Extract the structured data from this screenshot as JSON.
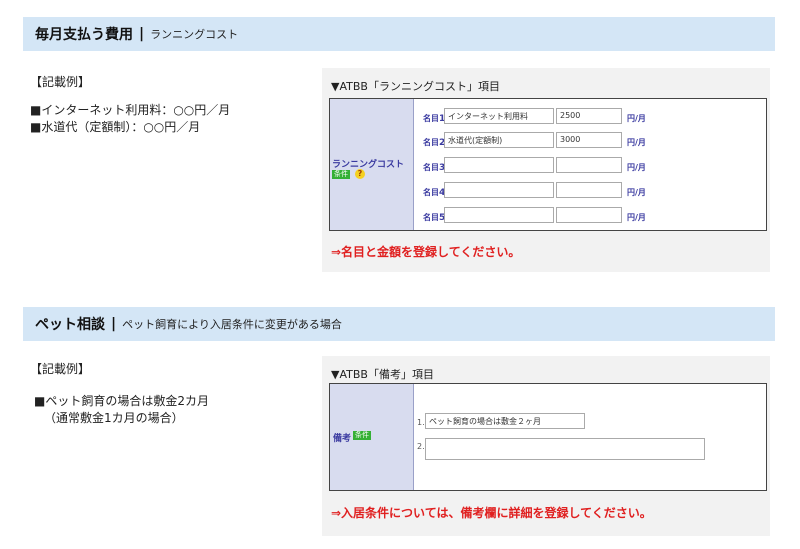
{
  "section1": {
    "title": "毎月支払う費用",
    "separator": "|",
    "subtitle": "ランニングコスト",
    "example_heading": "【記載例】",
    "example_lines": [
      "■インターネット利用料：○○円／月",
      "■水道代（定額制）：○○円／月"
    ],
    "panel_title": "▼ATBB「ランニングコスト」項目",
    "left_label": "ランニングコスト",
    "badge": "条件",
    "help": "?",
    "rows": [
      {
        "label": "名目",
        "num": "1",
        "name": "インターネット利用料",
        "amount": "2500",
        "unit": "円/月"
      },
      {
        "label": "名目",
        "num": "2",
        "name": "水道代(定額制)",
        "amount": "3000",
        "unit": "円/月"
      },
      {
        "label": "名目",
        "num": "3",
        "name": "",
        "amount": "",
        "unit": "円/月"
      },
      {
        "label": "名目",
        "num": "4",
        "name": "",
        "amount": "",
        "unit": "円/月"
      },
      {
        "label": "名目",
        "num": "5",
        "name": "",
        "amount": "",
        "unit": "円/月"
      }
    ],
    "note": "⇒名目と金額を登録してください。"
  },
  "section2": {
    "title": "ペット相談",
    "separator": "|",
    "subtitle": "ペット飼育により入居条件に変更がある場合",
    "example_heading": "【記載例】",
    "example_lines": [
      "■ペット飼育の場合は敷金2カ月",
      "（通常敷金1カ月の場合）"
    ],
    "panel_title": "▼ATBB「備考」項目",
    "left_label": "備考",
    "badge": "条件",
    "rows": [
      {
        "num": "1.",
        "value": "ペット飼育の場合は敷金２ヶ月"
      },
      {
        "num": "2.",
        "value": ""
      }
    ],
    "note": "⇒入居条件については、備考欄に詳細を登録してください。"
  }
}
